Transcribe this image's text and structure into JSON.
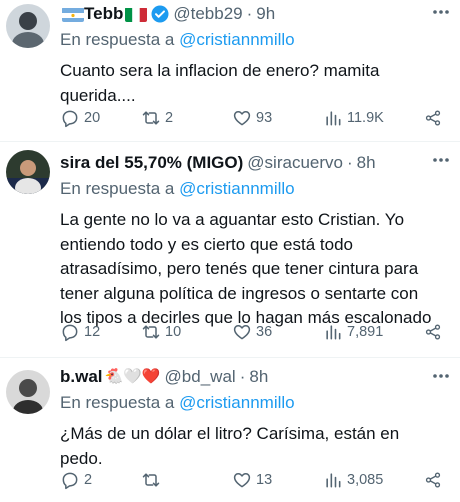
{
  "tweets": [
    {
      "name": "Tebb",
      "handle": "@tebb29",
      "sep": "·",
      "time": "9h",
      "reply_prefix": "En respuesta a",
      "reply_to": "@cristiannmillo",
      "text": "Cuanto sera la inflacion de enero? mamita querida....",
      "replies": "20",
      "retweets": "2",
      "likes": "93",
      "views": "11.9K"
    },
    {
      "name": "sira del 55,70% (MIGO)",
      "handle": "@siracuervo",
      "sep": "·",
      "time": "8h",
      "reply_prefix": "En respuesta a",
      "reply_to": "@cristiannmillo",
      "text": "La gente no lo va a aguantar esto Cristian. Yo entiendo todo y es cierto que está todo atrasadísimo, pero tenés que tener cintura para tener alguna política de ingresos o sentarte con los tipos a decirles que lo hagan más escalonado",
      "replies": "12",
      "retweets": "10",
      "likes": "36",
      "views": "7,891"
    },
    {
      "name": "b.wal",
      "name_emoji": "🐔🤍❤️",
      "handle": "@bd_wal",
      "sep": "·",
      "time": "8h",
      "reply_prefix": "En respuesta a",
      "reply_to": "@cristiannmillo",
      "text": "¿Más de un dólar el litro? Carísima, están en pedo.",
      "replies": "2",
      "retweets": "",
      "likes": "13",
      "views": "3,085"
    }
  ],
  "colors": {
    "accent": "#1d9bf0",
    "muted": "#536471",
    "text": "#0f1419"
  }
}
